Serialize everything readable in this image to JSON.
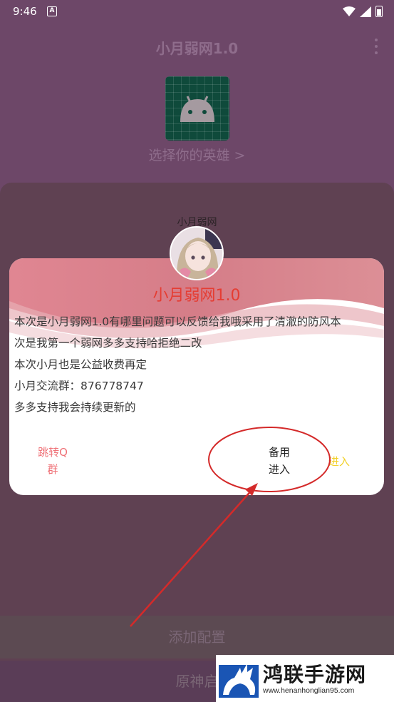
{
  "status_bar": {
    "time": "9:46",
    "notification_icon": "A"
  },
  "app": {
    "title": "小月弱网1.0",
    "hero_label": "选择你的英雄 >",
    "add_config_button": "添加配置",
    "launch_button": "原神启"
  },
  "dialog": {
    "caption": "小月弱网",
    "title": "小月弱网1.0",
    "lines": [
      "本次是小月弱网1.0有哪里问题可以反馈给我哦采用了清澈的防风本",
      "次是我第一个弱网多多支持哈拒绝二改",
      "本次小月也是公益收费再定",
      "小月交流群：876778747",
      "多多支持我会持续更新的"
    ],
    "buttons": {
      "qq_line1": "跳转Q",
      "qq_line2": "群",
      "backup_line1": "备用",
      "backup_line2": "进入",
      "enter": "进入"
    }
  },
  "watermark": {
    "name": "鸿联手游网",
    "url": "www.henanhonglian95.com"
  },
  "colors": {
    "primary": "#6d4768",
    "dialog_title": "#e53d33",
    "annotation": "#d42a2a",
    "enter": "#f2d12a"
  }
}
